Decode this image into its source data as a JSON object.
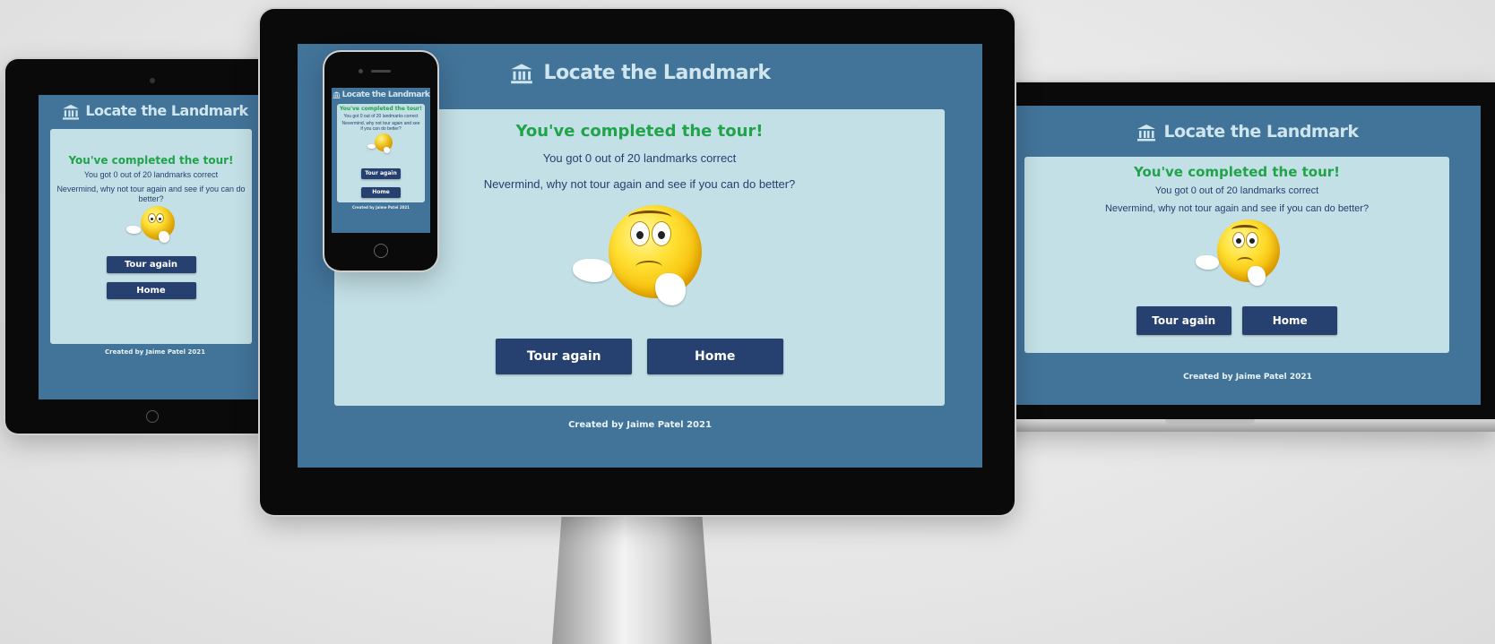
{
  "app": {
    "title": "Locate the Landmark",
    "brand_icon": "landmark-icon"
  },
  "result": {
    "heading": "You've completed the tour!",
    "score_text": "You got 0 out of 20 landmarks correct",
    "message": "Nevermind, why not tour again and see if you can do better?",
    "message_line1": "Nevermind, why not tour again and see if you can do",
    "message_line2": "better?",
    "phone_message_line1": "Nevermind, why not tour again and see",
    "phone_message_line2": "if you can do better?",
    "image": "thinking-emoji"
  },
  "buttons": {
    "tour_again": "Tour again",
    "home": "Home"
  },
  "footer": {
    "credit": "Created by Jaime Patel 2021"
  },
  "colors": {
    "page_bg": "#427399",
    "card_bg": "#c3e0e6",
    "heading_green": "#21a34a",
    "button_navy": "#26406f",
    "text_navy": "#233f6e"
  }
}
